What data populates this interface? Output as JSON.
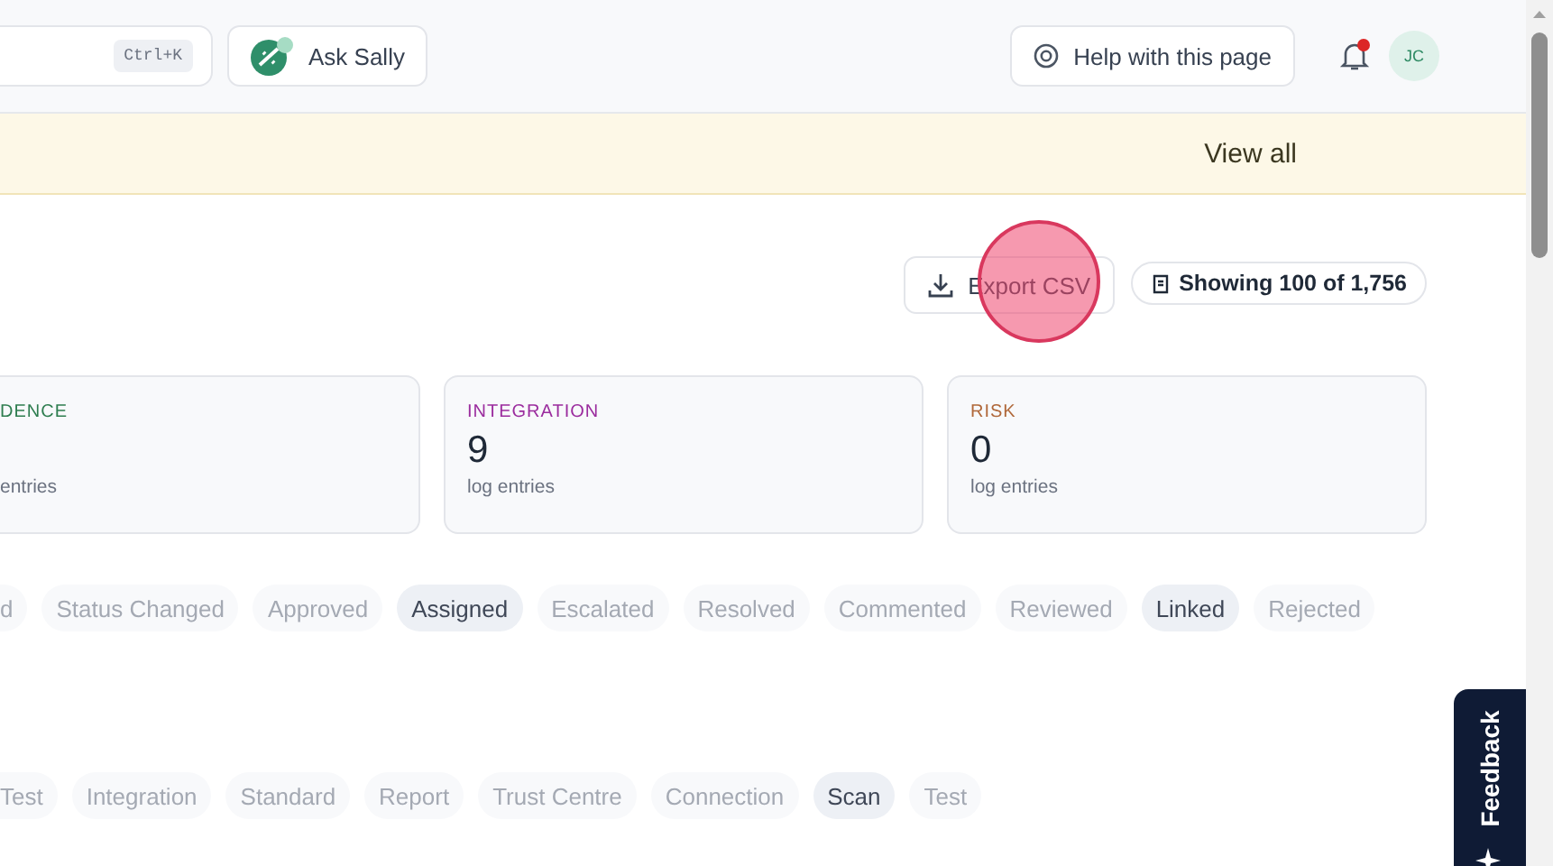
{
  "header": {
    "search": {
      "shortcut": "Ctrl+K"
    },
    "assistant_button": {
      "label": "Ask Sally"
    },
    "help_button": {
      "label": "Help with this page"
    },
    "notifications": {
      "unread": true
    },
    "avatar": {
      "initials": "JC"
    }
  },
  "banner": {
    "link": "View all"
  },
  "toolbar": {
    "export_button": {
      "label": "Export CSV"
    },
    "count_badge": {
      "label": "Showing 100 of 1,756"
    },
    "click_marker": true
  },
  "cards": [
    {
      "title": "DENCE",
      "subtitle": "entries",
      "color": "#2e7d4f"
    },
    {
      "title": "INTEGRATION",
      "value": "9",
      "subtitle": "log entries",
      "color": "#9b2c9e"
    },
    {
      "title": "RISK",
      "value": "0",
      "subtitle": "log entries",
      "color": "#b0683a"
    }
  ],
  "action_filters": [
    {
      "label": "d",
      "selected": false
    },
    {
      "label": "Status Changed",
      "selected": false
    },
    {
      "label": "Approved",
      "selected": false
    },
    {
      "label": "Assigned",
      "selected": true
    },
    {
      "label": "Escalated",
      "selected": false
    },
    {
      "label": "Resolved",
      "selected": false
    },
    {
      "label": "Commented",
      "selected": false
    },
    {
      "label": "Reviewed",
      "selected": false
    },
    {
      "label": "Linked",
      "selected": true
    },
    {
      "label": "Rejected",
      "selected": false
    }
  ],
  "type_filters": [
    {
      "label": "Test",
      "selected": false
    },
    {
      "label": "Integration",
      "selected": false
    },
    {
      "label": "Standard",
      "selected": false
    },
    {
      "label": "Report",
      "selected": false
    },
    {
      "label": "Trust Centre",
      "selected": false
    },
    {
      "label": "Connection",
      "selected": false
    },
    {
      "label": "Scan",
      "selected": true
    },
    {
      "label": "Test",
      "selected": false
    }
  ],
  "feedback_tab": {
    "label": "Feedback"
  }
}
